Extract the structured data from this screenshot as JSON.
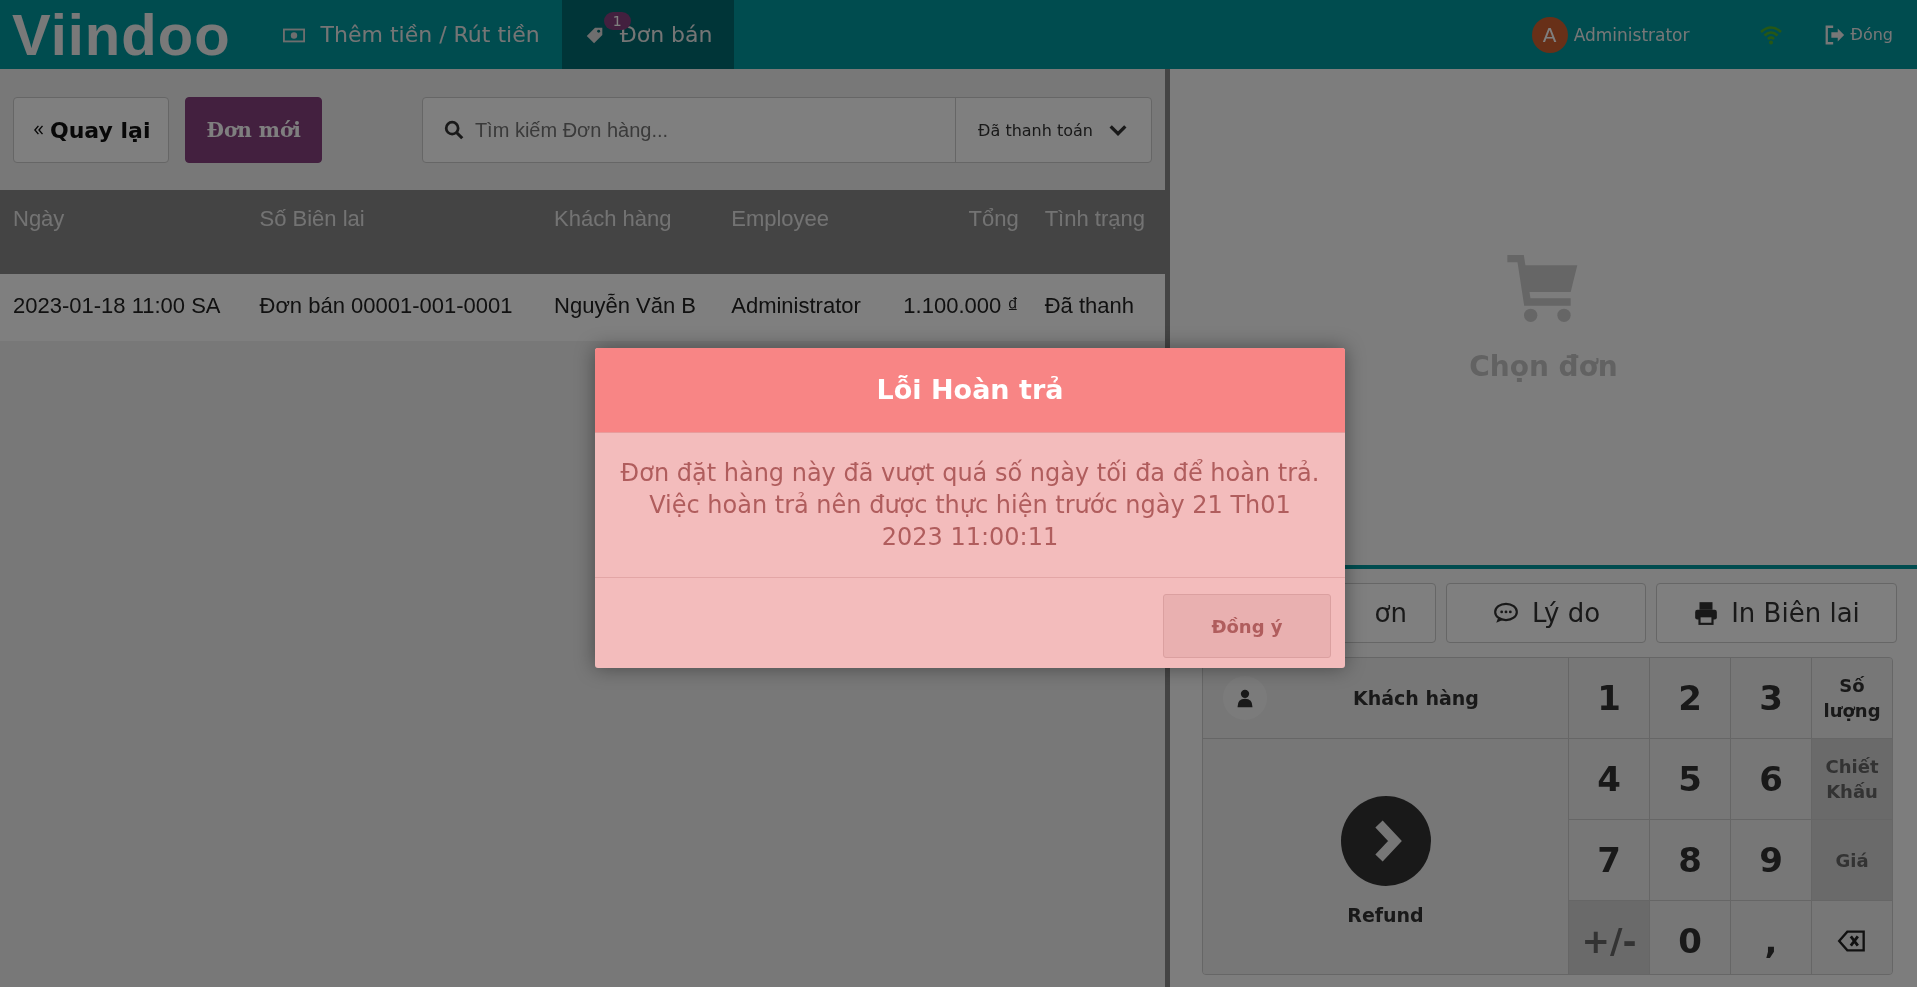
{
  "topbar": {
    "logo": "Viindoo",
    "tabs": [
      {
        "label": "Thêm tiền / Rút tiền",
        "selected": false
      },
      {
        "label": "Đơn bán",
        "badge": "1",
        "selected": true
      }
    ],
    "user": {
      "avatar": "A",
      "name": "Administrator"
    },
    "close_label": "Đóng"
  },
  "orders": {
    "back_label": "Quay lại",
    "new_label": "Đơn mới",
    "search": {
      "placeholder": "Tìm kiếm Đơn hàng..."
    },
    "filter": "Đã thanh toán",
    "columns": [
      "Ngày",
      "Số Biên lai",
      "Khách hàng",
      "Employee",
      "Tổng",
      "Tình trạng"
    ],
    "rows": [
      {
        "cells": [
          "2023-01-18 11:00 SA",
          "Đơn bán 00001-001-0001",
          "Nguyễn Văn B",
          "Administrator",
          "1.100.000 ₫",
          "Đã thanh"
        ]
      }
    ]
  },
  "detail": {
    "empty_label": "Chọn đơn",
    "actions": [
      "ơn",
      "Lý do",
      "In Biên lai"
    ],
    "customer_label": "Khách hàng",
    "refund_label": "Refund",
    "keys": [
      {
        "kind": "digit",
        "label": "1"
      },
      {
        "kind": "digit",
        "label": "2"
      },
      {
        "kind": "digit",
        "label": "3"
      },
      {
        "kind": "mode",
        "label": "Số lượng",
        "disabled": false
      },
      {
        "kind": "digit",
        "label": "4"
      },
      {
        "kind": "digit",
        "label": "5"
      },
      {
        "kind": "digit",
        "label": "6"
      },
      {
        "kind": "mode",
        "label": "Chiết Khấu",
        "disabled": true
      },
      {
        "kind": "digit",
        "label": "7"
      },
      {
        "kind": "digit",
        "label": "8"
      },
      {
        "kind": "digit",
        "label": "9"
      },
      {
        "kind": "mode",
        "label": "Giá",
        "disabled": true
      },
      {
        "kind": "sign",
        "label": "+/-",
        "disabled": true
      },
      {
        "kind": "digit",
        "label": "0"
      },
      {
        "kind": "digit",
        "label": ","
      },
      {
        "kind": "backspace"
      }
    ]
  },
  "dialog": {
    "title": "Lỗi Hoàn trả",
    "message": "Đơn đặt hàng này đã vượt quá số ngày tối đa để hoàn trả. Việc hoàn trả nên được thực hiện trước ngày 21 Th01 2023 11:00:11",
    "button": "Đồng ý"
  }
}
